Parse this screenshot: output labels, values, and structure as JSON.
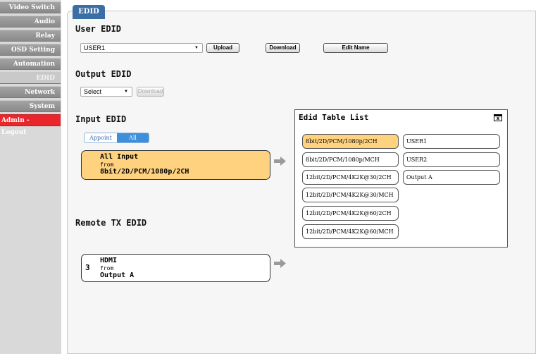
{
  "sidebar": {
    "items": [
      {
        "label": "Video Switch"
      },
      {
        "label": "Audio"
      },
      {
        "label": "Relay"
      },
      {
        "label": "OSD Setting"
      },
      {
        "label": "Automation"
      },
      {
        "label": "EDID"
      },
      {
        "label": "Network"
      },
      {
        "label": "System"
      },
      {
        "label": "Admin - Logout"
      }
    ],
    "active": "EDID"
  },
  "tab": {
    "label": "EDID"
  },
  "user_edid": {
    "title": "User EDID",
    "select_value": "USER1",
    "upload_label": "Upload",
    "download_label": "Download",
    "edit_name_label": "Edit Name"
  },
  "output_edid": {
    "title": "Output EDID",
    "select_value": "Select",
    "download_label": "Download"
  },
  "input_edid": {
    "title": "Input EDID",
    "toggle": {
      "appoint": "Appoint",
      "all": "All"
    },
    "box": {
      "line1": "All Input",
      "line2": "from",
      "line3": "8bit/2D/PCM/1080p/2CH"
    }
  },
  "remote_tx_edid": {
    "title": "Remote TX EDID",
    "box": {
      "number": "3",
      "line1": "HDMI",
      "line2": "from",
      "line3": "Output A"
    }
  },
  "edid_table": {
    "title": "Edid Table List",
    "left_items": [
      {
        "label": "8bit/2D/PCM/1080p/2CH"
      },
      {
        "label": "8bit/2D/PCM/1080p/MCH"
      },
      {
        "label": "12bit/2D/PCM/4K2K@30/2CH"
      },
      {
        "label": "12bit/2D/PCM/4K2K@30/MCH"
      },
      {
        "label": "12bit/2D/PCM/4K2K@60/2CH"
      },
      {
        "label": "12bit/2D/PCM/4K2K@60/MCH"
      }
    ],
    "right_items": [
      {
        "label": "USER1"
      },
      {
        "label": "USER2"
      },
      {
        "label": "Output A"
      }
    ],
    "close_glyph": "x"
  },
  "colors": {
    "accent": "#3b6ea5",
    "selected": "#ffd27f",
    "logout": "#e8262b"
  }
}
